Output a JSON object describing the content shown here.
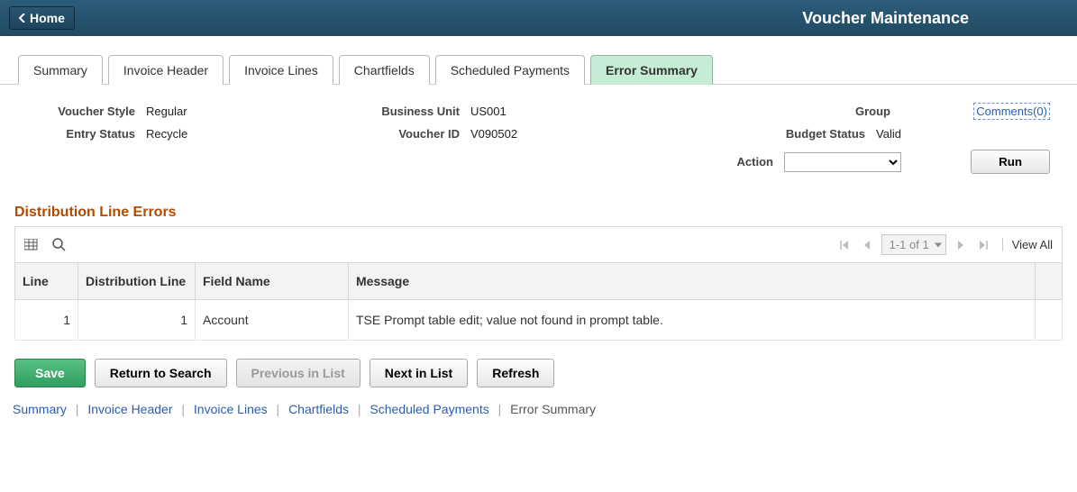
{
  "header": {
    "home_label": "Home",
    "page_title": "Voucher Maintenance"
  },
  "tabs": [
    {
      "label": "Summary",
      "active": false
    },
    {
      "label": "Invoice Header",
      "active": false
    },
    {
      "label": "Invoice Lines",
      "active": false
    },
    {
      "label": "Chartfields",
      "active": false
    },
    {
      "label": "Scheduled Payments",
      "active": false
    },
    {
      "label": "Error Summary",
      "active": true
    }
  ],
  "details": {
    "voucher_style": {
      "label": "Voucher Style",
      "value": "Regular"
    },
    "entry_status": {
      "label": "Entry Status",
      "value": "Recycle"
    },
    "business_unit": {
      "label": "Business Unit",
      "value": "US001"
    },
    "voucher_id": {
      "label": "Voucher ID",
      "value": "V090502"
    },
    "group": {
      "label": "Group",
      "value": ""
    },
    "budget_status": {
      "label": "Budget Status",
      "value": "Valid"
    },
    "action": {
      "label": "Action",
      "value": ""
    },
    "comments_link": "Comments(0)",
    "run_label": "Run"
  },
  "section_title": "Distribution Line Errors",
  "grid": {
    "page_indicator": "1-1 of 1",
    "view_all_label": "View All",
    "columns": [
      "Line",
      "Distribution Line",
      "Field Name",
      "Message"
    ],
    "rows": [
      {
        "line": "1",
        "distribution_line": "1",
        "field_name": "Account",
        "message": "TSE Prompt table edit; value not found in prompt table."
      }
    ]
  },
  "buttons": {
    "save": "Save",
    "return_to_search": "Return to Search",
    "previous_in_list": "Previous in List",
    "next_in_list": "Next in List",
    "refresh": "Refresh"
  },
  "bottom_nav": {
    "summary": "Summary",
    "invoice_header": "Invoice Header",
    "invoice_lines": "Invoice Lines",
    "chartfields": "Chartfields",
    "scheduled_payments": "Scheduled Payments",
    "error_summary": "Error Summary"
  }
}
